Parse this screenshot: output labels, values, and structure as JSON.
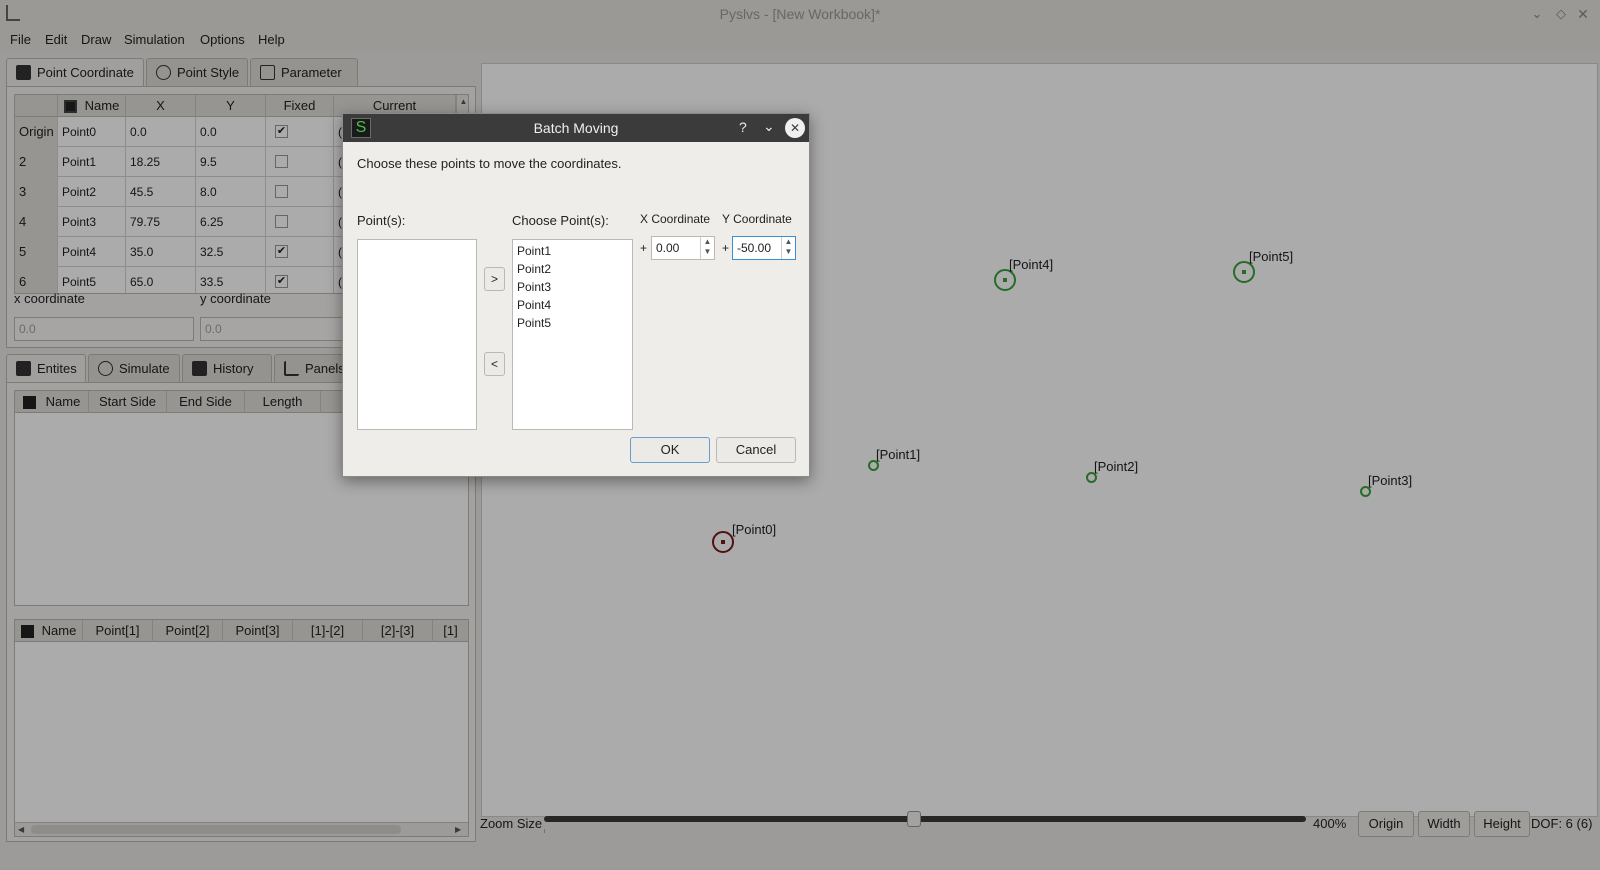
{
  "window": {
    "title": "Pyslvs - [New Workbook]*",
    "menus": [
      "File",
      "Edit",
      "Draw",
      "Simulation",
      "Options",
      "Help"
    ]
  },
  "top_tabs": [
    "Point Coordinate",
    "Point Style",
    "Parameter"
  ],
  "points_table": {
    "columns": [
      "Name",
      "X",
      "Y",
      "Fixed",
      "Current"
    ],
    "rows": [
      {
        "head": "Origin",
        "name": "Point0",
        "x": "0.0",
        "y": "0.0",
        "fixed": true,
        "current": "("
      },
      {
        "head": "2",
        "name": "Point1",
        "x": "18.25",
        "y": "9.5",
        "fixed": false,
        "current": "("
      },
      {
        "head": "3",
        "name": "Point2",
        "x": "45.5",
        "y": "8.0",
        "fixed": false,
        "current": "("
      },
      {
        "head": "4",
        "name": "Point3",
        "x": "79.75",
        "y": "6.25",
        "fixed": false,
        "current": "("
      },
      {
        "head": "5",
        "name": "Point4",
        "x": "35.0",
        "y": "32.5",
        "fixed": true,
        "current": "("
      },
      {
        "head": "6",
        "name": "Point5",
        "x": "65.0",
        "y": "33.5",
        "fixed": true,
        "current": "("
      }
    ]
  },
  "coord_inputs": {
    "x_label": "x coordinate",
    "x_placeholder": "0.0",
    "y_label": "y coordinate",
    "y_placeholder": "0.0"
  },
  "bottom_tabs": [
    "Entites",
    "Simulate",
    "History",
    "Panels"
  ],
  "links_table": {
    "columns": [
      "Name",
      "Start Side",
      "End Side",
      "Length"
    ]
  },
  "chains_table": {
    "columns": [
      "Name",
      "Point[1]",
      "Point[2]",
      "Point[3]",
      "[1]-[2]",
      "[2]-[3]",
      "[1]"
    ]
  },
  "canvas": {
    "points": [
      "[Point0]",
      "[Point1]",
      "[Point2]",
      "[Point3]",
      "[Point4]",
      "[Point5]"
    ]
  },
  "zoom": {
    "label": "Zoom Size",
    "value": "400%",
    "level": 0.485,
    "buttons": [
      "Origin",
      "Width",
      "Height"
    ],
    "dof": "DOF: 6 (6)"
  },
  "dialog": {
    "title": "Batch Moving",
    "help_icon": "?",
    "description": "Choose these points to move the coordinates.",
    "points_label": "Point(s):",
    "choose_label": "Choose Point(s):",
    "move_right": ">",
    "move_left": "<",
    "chosen_points": [
      "Point1",
      "Point2",
      "Point3",
      "Point4",
      "Point5"
    ],
    "x_label": "X Coordinate",
    "y_label": "Y Coordinate",
    "plus": "+",
    "x_value": "0.00",
    "y_value": "-50.00",
    "ok": "OK",
    "cancel": "Cancel"
  },
  "colors": {
    "fixed_point": "#7a1a1a",
    "free_point": "#3aa03a",
    "dialog_titlebar": "#3b3b3b",
    "focus": "#3d8fd1"
  }
}
